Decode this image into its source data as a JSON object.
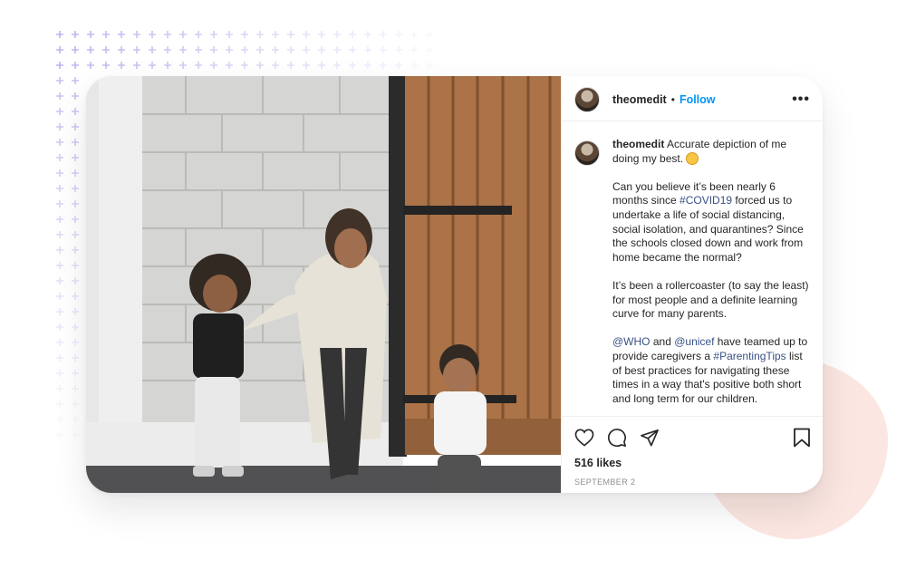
{
  "post": {
    "username": "theomedit",
    "separator": "•",
    "follow_label": "Follow",
    "more_label": "•••",
    "caption": {
      "username": "theomedit",
      "line1": "Accurate depiction of me doing my best.",
      "para2": "Can you believe it’s been nearly 6 months since ",
      "tag_covid": "#COVID19",
      "para2_rest": " forced us to undertake a life of social distancing, social isolation, and quarantines? Since the schools closed down and work from home became the normal?",
      "para3": "It’s been a rollercoaster (to say the least) for most people and a definite learning curve for many parents.",
      "mention_who": "@WHO",
      "and_text": " and ",
      "mention_unicef": "@unicef",
      "para4_mid": " have teamed up to provide caregivers a ",
      "tag_parenting": "#ParentingTips",
      "para4_rest": " list of best practices for navigating these times in a way that's positive both short and long term for our children."
    },
    "likes": "516 likes",
    "date": "SEPTEMBER 2"
  },
  "icons": {
    "like": "heart-icon",
    "comment": "comment-icon",
    "share": "paper-plane-icon",
    "save": "bookmark-icon",
    "more": "more-options-icon"
  },
  "colors": {
    "accent": "#0095f6",
    "link": "#385185",
    "pattern": "#b3b3ee",
    "blob": "#fbe6e1"
  }
}
